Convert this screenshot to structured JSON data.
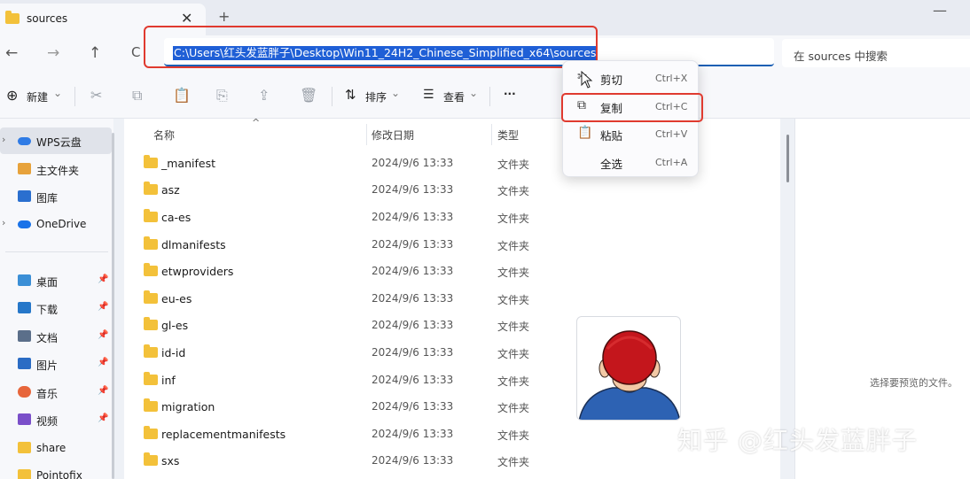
{
  "window": {
    "tab_title": "sources",
    "tab_close": "✕",
    "tab_new": "+",
    "minimize": "—"
  },
  "nav": {
    "back": "←",
    "forward": "→",
    "up": "↑",
    "refresh": "C",
    "address_path": "C:\\Users\\红头发蓝胖子\\Desktop\\Win11_24H2_Chinese_Simplified_x64\\sources",
    "search_placeholder": "在 sources 中搜索"
  },
  "toolbar": {
    "new_icon": "⊕",
    "new_label": "新建",
    "new_caret": "⌄",
    "cut_icon": "✂",
    "copy_icon": "⧉",
    "paste_icon": "📋",
    "rename_icon": "⎘",
    "share_icon": "⇪",
    "delete_icon": "🗑",
    "sort_icon": "⇅",
    "sort_label": "排序",
    "sort_caret": "⌄",
    "view_icon": "☰",
    "view_label": "查看",
    "view_caret": "⌄",
    "more_label": "···"
  },
  "sidebar": {
    "chevron": "›",
    "pin": "📌",
    "items": [
      {
        "label": "WPS云盘",
        "color": "#2f7be5"
      },
      {
        "label": "主文件夹",
        "color": "#e7a23b"
      },
      {
        "label": "图库",
        "color": "#2a6fcf"
      },
      {
        "label": "OneDrive",
        "color": "#1a73e8"
      },
      {
        "label": "桌面",
        "color": "#3b8fd6"
      },
      {
        "label": "下载",
        "color": "#2677c9"
      },
      {
        "label": "文档",
        "color": "#5b6f8a"
      },
      {
        "label": "图片",
        "color": "#2b6cc4"
      },
      {
        "label": "音乐",
        "color": "#e7663b"
      },
      {
        "label": "视频",
        "color": "#7a4fc9"
      },
      {
        "label": "share",
        "color": "#f3c13a"
      },
      {
        "label": "Pointofix",
        "color": "#f3c13a"
      }
    ]
  },
  "columns": {
    "name": "名称",
    "date": "修改日期",
    "type": "类型",
    "sort_caret": "^"
  },
  "files": [
    {
      "name": "_manifest",
      "date": "2024/9/6 13:33",
      "type": "文件夹"
    },
    {
      "name": "asz",
      "date": "2024/9/6 13:33",
      "type": "文件夹"
    },
    {
      "name": "ca-es",
      "date": "2024/9/6 13:33",
      "type": "文件夹"
    },
    {
      "name": "dlmanifests",
      "date": "2024/9/6 13:33",
      "type": "文件夹"
    },
    {
      "name": "etwproviders",
      "date": "2024/9/6 13:33",
      "type": "文件夹"
    },
    {
      "name": "eu-es",
      "date": "2024/9/6 13:33",
      "type": "文件夹"
    },
    {
      "name": "gl-es",
      "date": "2024/9/6 13:33",
      "type": "文件夹"
    },
    {
      "name": "id-id",
      "date": "2024/9/6 13:33",
      "type": "文件夹"
    },
    {
      "name": "inf",
      "date": "2024/9/6 13:33",
      "type": "文件夹"
    },
    {
      "name": "migration",
      "date": "2024/9/6 13:33",
      "type": "文件夹"
    },
    {
      "name": "replacementmanifests",
      "date": "2024/9/6 13:33",
      "type": "文件夹"
    },
    {
      "name": "sxs",
      "date": "2024/9/6 13:33",
      "type": "文件夹"
    }
  ],
  "preview": {
    "empty_text": "选择要预览的文件。"
  },
  "context_menu": {
    "items": [
      {
        "icon": "✂",
        "label": "剪切",
        "shortcut": "Ctrl+X"
      },
      {
        "icon": "⧉",
        "label": "复制",
        "shortcut": "Ctrl+C"
      },
      {
        "icon": "📋",
        "label": "粘贴",
        "shortcut": "Ctrl+V"
      },
      {
        "icon": "",
        "label": "全选",
        "shortcut": "Ctrl+A"
      }
    ]
  },
  "watermark": "知乎 @红头发蓝胖子",
  "colors": {
    "highlight_red": "#e03a2f",
    "selection_blue": "#1f5fd6",
    "folder_yellow": "#f3c13a"
  }
}
